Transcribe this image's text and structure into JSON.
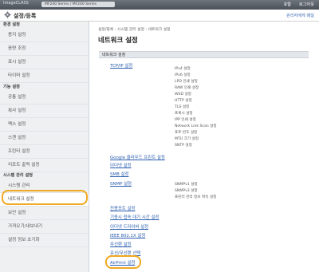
{
  "topbar": {
    "brand": "ImageCLASS",
    "device_tab": "MF240 Series / MF240 Series",
    "portal": "포탈",
    "logout": "로그아웃"
  },
  "header": {
    "title": "설정/등록",
    "admin_mode": "관리자에게 메일"
  },
  "sidebar": {
    "sections": [
      {
        "heading": "환경 설정",
        "items": [
          "용지 설정",
          "음량 조정",
          "표시 설정",
          "타이머 설정"
        ]
      },
      {
        "heading": "기능 설정",
        "items": [
          "공통 설정",
          "복사 설정",
          "팩스 설정",
          "스캔 설정",
          "프린터 설정",
          "리포트 출력 설정"
        ]
      },
      {
        "heading": "시스템 관리 설정",
        "items": [
          "시스템 관리",
          "네트워크 설정",
          "보안 설정",
          "가져오기/내보내기",
          "설정 정보 초기화"
        ]
      }
    ]
  },
  "breadcrumb": "설정/등록 : 시스템 관리 설정 : 네트워크 설정",
  "page_title": "네트워크 설정",
  "section_label": "네트워크 설정",
  "links": {
    "tcpip": "TCP/IP 설정",
    "google": "Google 클라우드 프린트 설정",
    "ethernet": "이더넷 설정",
    "smb": "SMB 설정",
    "snmp": "SNMP 설정",
    "port": "전용포트 설정",
    "wait": "기동시 접속 대기 시간 설정",
    "driver": "이더넷 드라이버 설정",
    "ieee": "IEEE 802.1X 설정",
    "wireless": "무선랜 설정",
    "wired_select": "유선/무선랜 선택",
    "airprint": "AirPrint 설정"
  },
  "tcpip_items": [
    "IPv4 설정",
    "IPv6 설정",
    "LPD 인쇄 설정",
    "RAW 인쇄 설정",
    "WSD 설정",
    "HTTP 설정",
    "TLS 설정",
    "프록시 설정",
    "IPP 인쇄 설정",
    "Network Link Scan 설정",
    "포트 번호 설정",
    "MTU 크기 설정",
    "SNTP 설정"
  ],
  "snmp_items": [
    "SNMPv1 설정",
    "SNMPv3 설정",
    "프린터 관리 정보 취득 설정"
  ],
  "colors": {
    "link": "#2b5fb0",
    "highlight": "#f0a820",
    "sidebar": "#eef0f2"
  },
  "icons": {
    "header": "gear-icon"
  }
}
